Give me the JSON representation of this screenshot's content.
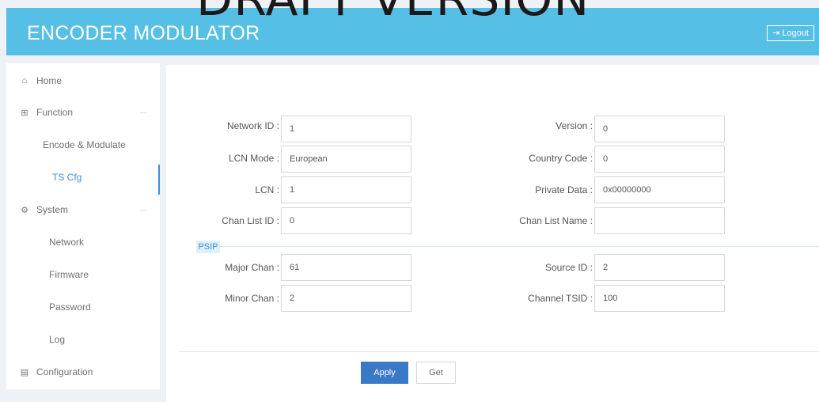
{
  "header": {
    "title": "ENCODER MODULATOR",
    "watermark": "DRAFT VERSION",
    "logout_label": "Logout",
    "logout_icon": "logout-icon"
  },
  "sidebar": {
    "items": [
      {
        "label": "Home",
        "icon": "home-icon"
      },
      {
        "label": "Function",
        "icon": "grid-icon"
      },
      {
        "label": "Encode & Modulate"
      },
      {
        "label": "TS Cfg"
      },
      {
        "label": "System",
        "icon": "gear-icon"
      },
      {
        "label": "Network"
      },
      {
        "label": "Firmware"
      },
      {
        "label": "Password"
      },
      {
        "label": "Log"
      },
      {
        "label": "Configuration",
        "icon": "document-icon"
      }
    ]
  },
  "form": {
    "network_id": {
      "label": "Network ID :",
      "value": "1"
    },
    "version": {
      "label": "Version :",
      "value": "0"
    },
    "lcn_mode": {
      "label": "LCN Mode :",
      "value": "European"
    },
    "country_code": {
      "label": "Country Code :",
      "value": "0"
    },
    "lcn": {
      "label": "LCN :",
      "value": "1"
    },
    "private_data": {
      "label": "Private Data :",
      "value": "0x00000000"
    },
    "chan_list_id": {
      "label": "Chan List ID :",
      "value": "0"
    },
    "chan_list_name": {
      "label": "Chan List Name :",
      "value": ""
    },
    "psip_label": "PSIP",
    "major_chan": {
      "label": "Major Chan :",
      "value": "61"
    },
    "source_id": {
      "label": "Source ID :",
      "value": "2"
    },
    "minor_chan": {
      "label": "Minor Chan :",
      "value": "2"
    },
    "channel_tsid": {
      "label": "Channel TSID :",
      "value": "100"
    }
  },
  "buttons": {
    "apply": "Apply",
    "get": "Get"
  },
  "colors": {
    "header": "#56bfe6",
    "accent": "#3f8ed8",
    "apply": "#3a78c8"
  }
}
